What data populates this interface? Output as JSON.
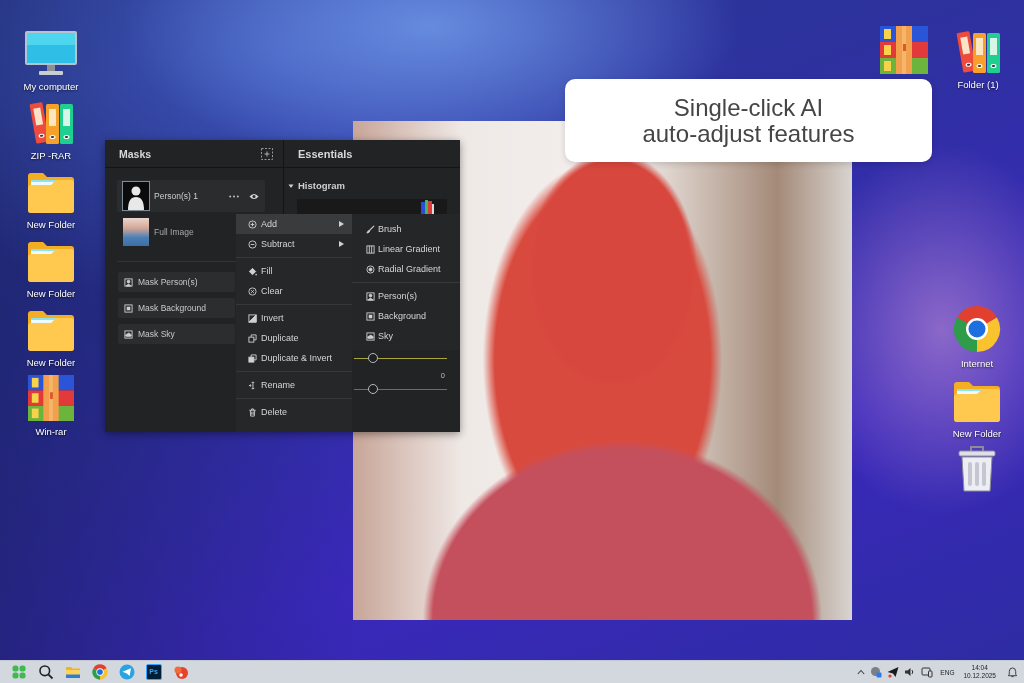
{
  "desktop": {
    "left_shortcuts": [
      {
        "label": "My computer",
        "kind": "monitor"
      },
      {
        "label": "ZIP -RAR",
        "kind": "binders"
      },
      {
        "label": "New Folder",
        "kind": "folder"
      },
      {
        "label": "New Folder",
        "kind": "folder"
      },
      {
        "label": "New Folder",
        "kind": "folder"
      },
      {
        "label": "Win-rar",
        "kind": "archive"
      }
    ],
    "top_right_shortcuts": [
      {
        "kind": "archive"
      },
      {
        "label": "Folder (1)",
        "kind": "binders"
      }
    ],
    "right_shortcuts": [
      {
        "label": "Internet",
        "kind": "browser"
      },
      {
        "label": "New Folder",
        "kind": "folder"
      },
      {
        "kind": "trash"
      }
    ]
  },
  "callout": {
    "text": "Single-click AI\nauto-adjust features"
  },
  "masks_panel": {
    "title": "Masks",
    "layers": [
      {
        "name": "Person(s) 1",
        "kind": "person",
        "selected": true
      },
      {
        "name": "Full Image",
        "kind": "image",
        "selected": false
      }
    ],
    "mask_buttons": [
      {
        "label": "Mask Person(s)",
        "kind": "person"
      },
      {
        "label": "Mask Background",
        "kind": "background"
      },
      {
        "label": "Mask Sky",
        "kind": "sky"
      }
    ]
  },
  "essentials_panel": {
    "title": "Essentials",
    "histogram": {
      "label": "Histogram",
      "expanded": true
    },
    "sliders": [
      {
        "level": 0.2,
        "color": "#a9a63e"
      },
      {
        "level": 0.2,
        "color": "#9e4e86",
        "reading": "0"
      }
    ]
  },
  "context_menu": {
    "groups": [
      [
        {
          "label": "Add",
          "kind": "add",
          "submenu": true,
          "selected": true
        },
        {
          "label": "Subtract",
          "kind": "subtract",
          "submenu": true,
          "selected": false
        }
      ],
      [
        {
          "label": "Fill",
          "kind": "fill",
          "submenu": false,
          "selected": false
        },
        {
          "label": "Clear",
          "kind": "clear",
          "submenu": false,
          "selected": false
        }
      ],
      [
        {
          "label": "Invert",
          "kind": "invert",
          "submenu": false,
          "selected": false
        },
        {
          "label": "Duplicate",
          "kind": "duplicate",
          "submenu": false,
          "selected": false
        },
        {
          "label": "Duplicate & Invert",
          "kind": "duplicate-invert",
          "submenu": false,
          "selected": false
        }
      ],
      [
        {
          "label": "Rename",
          "kind": "rename",
          "submenu": false,
          "selected": false
        }
      ],
      [
        {
          "label": "Delete",
          "kind": "delete",
          "submenu": false,
          "selected": false
        }
      ]
    ],
    "submenu": {
      "groups": [
        [
          {
            "label": "Brush",
            "kind": "brush",
            "selected": false
          },
          {
            "label": "Linear Gradient",
            "kind": "linear-gradient",
            "selected": false
          },
          {
            "label": "Radial Gradient",
            "kind": "radial-gradient",
            "selected": false
          }
        ],
        [
          {
            "label": "Person(s)",
            "kind": "person",
            "selected": false
          },
          {
            "label": "Background",
            "kind": "background",
            "selected": false
          },
          {
            "label": "Sky",
            "kind": "sky",
            "selected": false
          }
        ]
      ]
    }
  },
  "taskbar": {
    "apps": [
      {
        "kind": "start"
      },
      {
        "kind": "search"
      },
      {
        "kind": "files"
      },
      {
        "kind": "browser"
      },
      {
        "kind": "messenger"
      },
      {
        "kind": "photo-editor",
        "label": "Ps"
      },
      {
        "kind": "app"
      }
    ],
    "language": "ENG",
    "time": "14:04",
    "date": "10.12.2025"
  }
}
